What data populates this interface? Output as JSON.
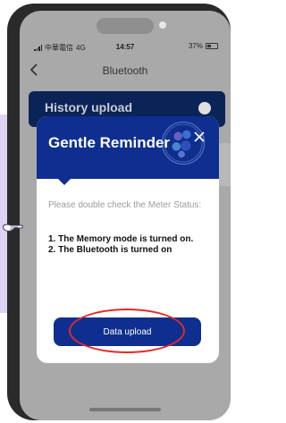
{
  "status_bar": {
    "carrier": "中華電信",
    "network": "4G",
    "time": "14:57",
    "battery": "37%"
  },
  "nav": {
    "title": "Bluetooth"
  },
  "background": {
    "card_label": "History upload"
  },
  "modal": {
    "title": "Gentle Reminder",
    "subtitle": "Please double check the Meter Status:",
    "items": [
      "1. The Memory mode is turned on.",
      "2. The Bluetooth is turned on"
    ],
    "button_label": "Data upload"
  },
  "colors": {
    "accent": "#0e2f8f",
    "highlight": "#e02a2a",
    "guide": "#ddd3f2"
  },
  "icons": [
    "back-arrow-icon",
    "close-icon",
    "signal-icon",
    "battery-icon",
    "hand-pointer-icon",
    "logo-icon"
  ]
}
